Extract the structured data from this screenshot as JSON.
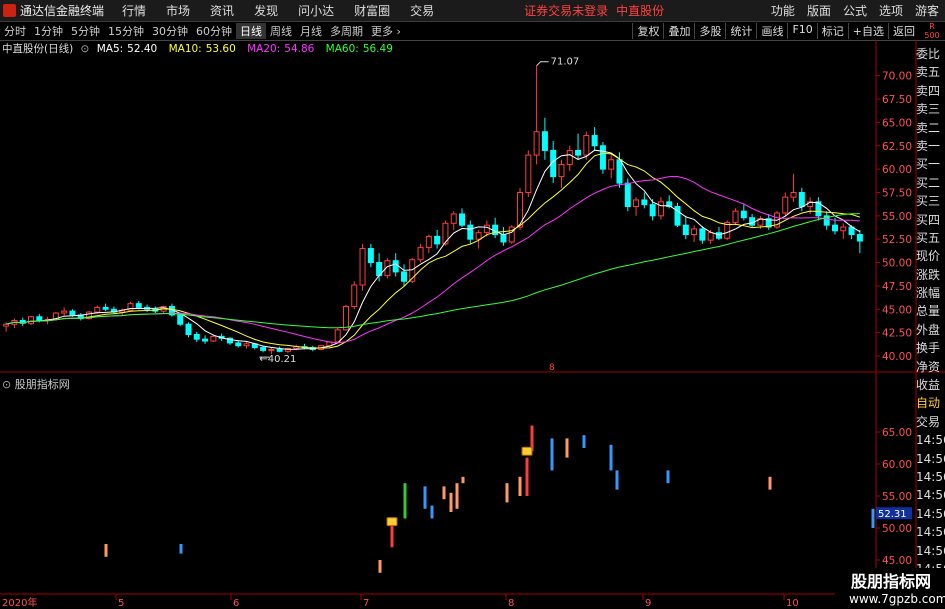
{
  "app": {
    "title": "通达信金融终端",
    "menus": [
      "行情",
      "市场",
      "资讯",
      "发现",
      "问小达",
      "财富圈",
      "交易"
    ],
    "warning": "证券交易未登录",
    "stock_name": "中直股份",
    "right_menus": [
      "功能",
      "版面",
      "公式",
      "选项"
    ],
    "guest": "游客"
  },
  "toolbar": {
    "periods": [
      "分时",
      "1分钟",
      "5分钟",
      "15分钟",
      "30分钟",
      "60分钟",
      "日线",
      "周线",
      "月线",
      "多周期",
      "更多"
    ],
    "active": "日线",
    "right_buttons": [
      "复权",
      "叠加",
      "多股",
      "统计",
      "画线",
      "F10",
      "标记",
      "+自选",
      "返回"
    ]
  },
  "r_label": {
    "r": "R",
    "num": "500"
  },
  "chart_title": "中直股份(日线)",
  "ma": [
    {
      "label": "MA5:",
      "value": "52.40",
      "color": "#ffffff"
    },
    {
      "label": "MA10:",
      "value": "53.60",
      "color": "#ffff33"
    },
    {
      "label": "MA20:",
      "value": "54.86",
      "color": "#ff33ff"
    },
    {
      "label": "MA60:",
      "value": "56.49",
      "color": "#33ff33"
    }
  ],
  "indicator_title": "股朋指标网",
  "price_ticks": [
    "70.00",
    "67.50",
    "65.00",
    "62.50",
    "60.00",
    "57.50",
    "55.00",
    "52.50",
    "50.00",
    "47.50",
    "45.00",
    "42.50",
    "40.00"
  ],
  "ind_ticks": [
    "65.00",
    "60.00",
    "55.00",
    "50.00",
    "45.00"
  ],
  "annotations": {
    "high": "71.07",
    "low": "40.21",
    "marker": "8",
    "current": "52.31"
  },
  "x_labels": [
    "2020年",
    "5",
    "6",
    "7",
    "8",
    "9",
    "10"
  ],
  "quote_panel": [
    "委比",
    "卖五",
    "卖四",
    "卖三",
    "卖二",
    "卖一",
    "买一",
    "买二",
    "买三",
    "买四",
    "买五",
    "现价",
    "涨跌",
    "涨幅",
    "总量",
    "外盘",
    "换手",
    "净资",
    "收益",
    "自动",
    "交易",
    "14:56",
    "14:56",
    "14:56",
    "14:56",
    "14:56",
    "14:56",
    "14:56",
    "14:56",
    "14:56"
  ],
  "watermark": {
    "line1": "股朋指标网",
    "line2": "www.7gpzb.com"
  },
  "colors": {
    "up": "#ff3c3c",
    "down": "#00ffff",
    "ma5": "#ffffff",
    "ma10": "#ffff33",
    "ma20": "#ff33ff",
    "ma60": "#33ff33"
  },
  "chart_data": {
    "type": "candlestick",
    "ylim": [
      38.5,
      72
    ],
    "candles": [
      [
        43.2,
        43.6,
        42.6,
        43.4
      ],
      [
        43.4,
        44.0,
        43.0,
        43.8
      ],
      [
        43.8,
        44.1,
        43.2,
        43.5
      ],
      [
        43.5,
        44.3,
        43.3,
        44.2
      ],
      [
        44.2,
        44.5,
        43.6,
        43.8
      ],
      [
        43.8,
        44.2,
        43.4,
        43.9
      ],
      [
        43.9,
        44.7,
        43.8,
        44.6
      ],
      [
        44.6,
        45.2,
        44.3,
        44.8
      ],
      [
        44.8,
        45.0,
        44.2,
        44.4
      ],
      [
        44.4,
        44.6,
        43.8,
        44.0
      ],
      [
        44.0,
        44.8,
        43.9,
        44.7
      ],
      [
        44.7,
        45.4,
        44.5,
        45.2
      ],
      [
        45.2,
        45.6,
        44.8,
        45.0
      ],
      [
        45.0,
        45.3,
        44.5,
        44.7
      ],
      [
        44.7,
        45.1,
        44.3,
        44.9
      ],
      [
        44.9,
        45.8,
        44.8,
        45.6
      ],
      [
        45.6,
        45.9,
        45.0,
        45.2
      ],
      [
        45.2,
        45.5,
        44.7,
        45.0
      ],
      [
        45.0,
        45.3,
        44.6,
        44.8
      ],
      [
        44.8,
        45.4,
        44.6,
        45.3
      ],
      [
        45.3,
        45.6,
        44.2,
        44.4
      ],
      [
        44.4,
        44.6,
        43.2,
        43.4
      ],
      [
        43.4,
        43.6,
        42.0,
        42.3
      ],
      [
        42.3,
        42.6,
        41.5,
        41.8
      ],
      [
        41.8,
        42.2,
        41.3,
        41.6
      ],
      [
        41.6,
        42.3,
        41.5,
        42.1
      ],
      [
        42.1,
        42.4,
        41.6,
        41.9
      ],
      [
        41.9,
        42.0,
        41.2,
        41.4
      ],
      [
        41.4,
        41.7,
        40.9,
        41.1
      ],
      [
        41.1,
        41.5,
        40.8,
        41.3
      ],
      [
        41.3,
        41.4,
        40.7,
        40.9
      ],
      [
        40.9,
        41.1,
        40.4,
        40.6
      ],
      [
        40.6,
        40.9,
        40.2,
        40.7
      ],
      [
        40.7,
        41.0,
        40.4,
        40.5
      ],
      [
        40.5,
        40.9,
        40.3,
        40.8
      ],
      [
        40.8,
        41.2,
        40.6,
        41.0
      ],
      [
        41.0,
        41.3,
        40.7,
        40.9
      ],
      [
        40.9,
        41.1,
        40.5,
        40.7
      ],
      [
        40.7,
        41.2,
        40.6,
        41.1
      ],
      [
        41.1,
        41.6,
        41.0,
        41.5
      ],
      [
        41.5,
        43.0,
        41.4,
        42.8
      ],
      [
        42.8,
        45.5,
        42.7,
        45.3
      ],
      [
        45.3,
        48.0,
        45.0,
        47.6
      ],
      [
        47.6,
        52.0,
        47.0,
        51.5
      ],
      [
        51.5,
        52.0,
        49.5,
        50.0
      ],
      [
        50.0,
        51.0,
        48.0,
        48.6
      ],
      [
        48.6,
        50.5,
        48.3,
        50.2
      ],
      [
        50.2,
        51.0,
        48.5,
        49.0
      ],
      [
        49.0,
        49.8,
        47.5,
        48.0
      ],
      [
        48.0,
        50.5,
        47.8,
        50.3
      ],
      [
        50.3,
        52.0,
        50.0,
        51.6
      ],
      [
        51.6,
        53.0,
        51.0,
        52.8
      ],
      [
        52.8,
        53.5,
        51.5,
        52.0
      ],
      [
        52.0,
        54.5,
        51.8,
        54.2
      ],
      [
        54.2,
        55.5,
        53.5,
        55.2
      ],
      [
        55.2,
        55.8,
        53.8,
        54.0
      ],
      [
        54.0,
        54.5,
        52.0,
        52.5
      ],
      [
        52.5,
        53.5,
        51.5,
        53.2
      ],
      [
        53.2,
        54.5,
        52.8,
        54.0
      ],
      [
        54.0,
        54.8,
        52.6,
        53.0
      ],
      [
        53.0,
        53.8,
        51.8,
        52.2
      ],
      [
        52.2,
        54.0,
        52.0,
        53.8
      ],
      [
        53.8,
        58.0,
        53.5,
        57.5
      ],
      [
        57.5,
        62.0,
        57.0,
        61.5
      ],
      [
        61.5,
        71.07,
        60.5,
        64.0
      ],
      [
        64.0,
        65.5,
        61.0,
        62.0
      ],
      [
        62.0,
        63.0,
        58.5,
        59.2
      ],
      [
        59.2,
        61.0,
        58.0,
        60.5
      ],
      [
        60.5,
        62.5,
        59.8,
        62.0
      ],
      [
        62.0,
        63.8,
        61.0,
        61.5
      ],
      [
        61.5,
        64.0,
        61.0,
        63.6
      ],
      [
        63.6,
        64.5,
        62.0,
        62.5
      ],
      [
        62.5,
        62.9,
        59.5,
        60.0
      ],
      [
        60.0,
        61.5,
        59.0,
        61.0
      ],
      [
        61.0,
        61.8,
        58.0,
        58.5
      ],
      [
        58.5,
        59.0,
        55.5,
        56.0
      ],
      [
        56.0,
        57.0,
        55.0,
        56.7
      ],
      [
        56.7,
        57.5,
        55.8,
        56.2
      ],
      [
        56.2,
        56.8,
        54.5,
        55.0
      ],
      [
        55.0,
        57.0,
        54.6,
        56.5
      ],
      [
        56.5,
        57.2,
        55.8,
        56.0
      ],
      [
        56.0,
        56.4,
        53.8,
        54.0
      ],
      [
        54.0,
        55.0,
        52.5,
        53.0
      ],
      [
        53.0,
        54.0,
        52.2,
        53.6
      ],
      [
        53.6,
        53.9,
        52.0,
        52.4
      ],
      [
        52.4,
        53.5,
        52.0,
        53.2
      ],
      [
        53.2,
        53.8,
        52.4,
        52.6
      ],
      [
        52.6,
        54.5,
        52.4,
        54.3
      ],
      [
        54.3,
        55.8,
        54.0,
        55.5
      ],
      [
        55.5,
        56.2,
        54.5,
        54.8
      ],
      [
        54.8,
        55.2,
        53.8,
        54.0
      ],
      [
        54.0,
        55.0,
        53.6,
        54.7
      ],
      [
        54.7,
        55.2,
        53.5,
        53.8
      ],
      [
        53.8,
        55.5,
        53.6,
        55.3
      ],
      [
        55.3,
        57.5,
        55.0,
        57.0
      ],
      [
        57.0,
        59.5,
        56.5,
        57.5
      ],
      [
        57.5,
        58.0,
        55.5,
        56.0
      ],
      [
        56.0,
        57.0,
        55.2,
        56.5
      ],
      [
        56.5,
        57.0,
        54.5,
        55.0
      ],
      [
        55.0,
        55.5,
        53.5,
        54.0
      ],
      [
        54.0,
        54.8,
        53.0,
        53.4
      ],
      [
        53.4,
        54.2,
        52.5,
        53.8
      ],
      [
        53.8,
        54.0,
        52.5,
        53.0
      ],
      [
        53.0,
        53.5,
        51.0,
        52.31
      ]
    ],
    "ind_bars": [
      [
        106,
        47.5,
        45.5,
        "#ff9966"
      ],
      [
        181,
        47.5,
        46.0,
        "#3399ff"
      ],
      [
        380,
        45.0,
        43.0,
        "#ff9966"
      ],
      [
        392,
        51.0,
        47.0,
        "#ff3c3c"
      ],
      [
        405,
        57.0,
        51.5,
        "#33cc33"
      ],
      [
        425,
        56.5,
        53.0,
        "#3399ff"
      ],
      [
        432,
        53.5,
        51.5,
        "#3399ff"
      ],
      [
        444,
        56.5,
        54.5,
        "#ff9966"
      ],
      [
        451,
        55.5,
        52.5,
        "#ff9966"
      ],
      [
        457,
        57.0,
        53.0,
        "#ff9966"
      ],
      [
        463,
        58.0,
        57.0,
        "#ff9966"
      ],
      [
        507,
        57.0,
        54.0,
        "#ff9966"
      ],
      [
        520,
        58.0,
        55.0,
        "#ff9966"
      ],
      [
        527,
        61.0,
        55.0,
        "#ff3c3c"
      ],
      [
        532,
        66.0,
        62.0,
        "#ff3c3c"
      ],
      [
        552,
        64.0,
        59.0,
        "#3399ff"
      ],
      [
        567,
        64.0,
        61.0,
        "#ff9966"
      ],
      [
        584,
        64.5,
        62.5,
        "#3399ff"
      ],
      [
        611,
        63.0,
        59.0,
        "#3399ff"
      ],
      [
        617,
        59.0,
        56.0,
        "#3399ff"
      ],
      [
        668,
        59.0,
        57.0,
        "#3399ff"
      ],
      [
        770,
        58.0,
        56.0,
        "#ff9966"
      ],
      [
        873,
        53.0,
        50.0,
        "#3399ff"
      ]
    ]
  }
}
